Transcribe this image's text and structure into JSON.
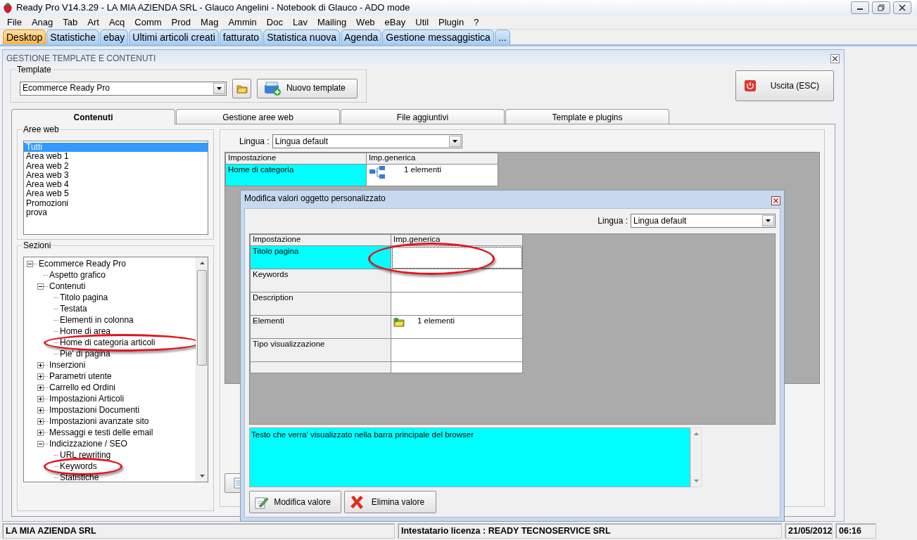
{
  "window": {
    "title": "Ready Pro V14.3.29 - LA MIA AZIENDA SRL - Glauco Angelini - Notebook di Glauco - ADO mode"
  },
  "menu": [
    "File",
    "Anag",
    "Tab",
    "Art",
    "Acq",
    "Comm",
    "Prod",
    "Mag",
    "Ammin",
    "Doc",
    "Lav",
    "Mailing",
    "Web",
    "eBay",
    "Util",
    "Plugin",
    "?"
  ],
  "tabs": [
    {
      "label": "Desktop",
      "selected": true
    },
    {
      "label": "Statistiche",
      "selected": false
    },
    {
      "label": "ebay",
      "selected": false
    },
    {
      "label": "Ultimi articoli creati",
      "selected": false
    },
    {
      "label": "fatturato",
      "selected": false
    },
    {
      "label": "Statistica nuova",
      "selected": false
    },
    {
      "label": "Agenda",
      "selected": false
    },
    {
      "label": "Gestione messaggistica",
      "selected": false
    },
    {
      "label": "...",
      "selected": false
    }
  ],
  "panel": {
    "title": "GESTIONE TEMPLATE E CONTENUTI",
    "template": {
      "label": "Template",
      "value": "Ecommerce Ready Pro",
      "new_button": "Nuovo template"
    },
    "exit_button": "Uscita (ESC)",
    "inner_tabs": [
      {
        "label": "Contenuti",
        "selected": true
      },
      {
        "label": "Gestione aree web",
        "selected": false
      },
      {
        "label": "File aggiuntivi",
        "selected": false
      },
      {
        "label": "Template e plugins",
        "selected": false
      }
    ],
    "aree_web": {
      "label": "Aree web",
      "items": [
        {
          "label": "Tutti",
          "selected": true
        },
        {
          "label": "Area web 1",
          "selected": false
        },
        {
          "label": "Area web 2",
          "selected": false
        },
        {
          "label": "Area web 3",
          "selected": false
        },
        {
          "label": "Area web 4",
          "selected": false
        },
        {
          "label": "Area web 5",
          "selected": false
        },
        {
          "label": "Promozioni",
          "selected": false
        },
        {
          "label": "prova",
          "selected": false
        }
      ]
    },
    "sezioni": {
      "label": "Sezioni",
      "tree": [
        {
          "label": "Ecommerce Ready Pro",
          "expanded": true,
          "circled": false,
          "children": [
            {
              "label": "Aspetto grafico",
              "circled": false
            },
            {
              "label": "Contenuti",
              "expanded": true,
              "circled": false,
              "children": [
                {
                  "label": "Titolo pagina",
                  "circled": false
                },
                {
                  "label": "Testata",
                  "circled": false
                },
                {
                  "label": "Elementi in colonna",
                  "circled": false
                },
                {
                  "label": "Home di area",
                  "circled": false
                },
                {
                  "label": "Home di categoria articoli",
                  "circled": true
                },
                {
                  "label": "Pie' di pagina",
                  "circled": false
                }
              ]
            },
            {
              "label": "Inserzioni",
              "expanded": false,
              "circled": false
            },
            {
              "label": "Parametri utente",
              "expanded": false,
              "circled": false
            },
            {
              "label": "Carrello ed Ordini",
              "expanded": false,
              "circled": false
            },
            {
              "label": "Impostazioni Articoli",
              "expanded": false,
              "circled": false
            },
            {
              "label": "Impostazioni Documenti",
              "expanded": false,
              "circled": false
            },
            {
              "label": "Impostazioni avanzate sito",
              "expanded": false,
              "circled": false
            },
            {
              "label": "Messaggi e testi delle email",
              "expanded": false,
              "circled": false
            },
            {
              "label": "Indicizzazione / SEO",
              "expanded": true,
              "circled": false,
              "children": [
                {
                  "label": "URL rewriting",
                  "circled": false
                },
                {
                  "label": "Keywords",
                  "circled": true
                },
                {
                  "label": "Statistiche",
                  "circled": false
                }
              ]
            }
          ]
        }
      ]
    },
    "grid": {
      "lingua_label": "Lingua :",
      "lingua_value": "Lingua default",
      "columns": [
        "Impostazione",
        "Imp.generica"
      ],
      "rows": [
        {
          "setting": "Home di categoria",
          "value": "1 elementi",
          "kind": "tree",
          "selected": true
        }
      ]
    }
  },
  "dialog": {
    "title": "Modifica valori oggetto personalizzato",
    "lingua_label": "Lingua :",
    "lingua_value": "Lingua default",
    "columns": [
      "Impostazione",
      "Imp.generica"
    ],
    "rows": [
      {
        "setting": "Titolo pagina",
        "selected": true,
        "circled": true
      },
      {
        "setting": "Keywords",
        "selected": false,
        "circled": false
      },
      {
        "setting": "Description",
        "selected": false,
        "circled": false
      },
      {
        "setting": "Elementi",
        "value": "1 elementi",
        "kind": "folder",
        "selected": false,
        "circled": false
      },
      {
        "setting": "Tipo visualizzazione",
        "selected": false,
        "circled": false
      }
    ],
    "description": "Testo che verra' visualizzato nella barra principale del browser",
    "buttons": [
      {
        "label": "Modifica valore",
        "kind": "edit"
      },
      {
        "label": "Elimina valore",
        "kind": "delete"
      }
    ]
  },
  "status_bar": {
    "company": "LA MIA AZIENDA SRL",
    "license": "Intestatario licenza : READY TECNOSERVICE SRL",
    "date": "21/05/2012",
    "time": "06:16"
  }
}
